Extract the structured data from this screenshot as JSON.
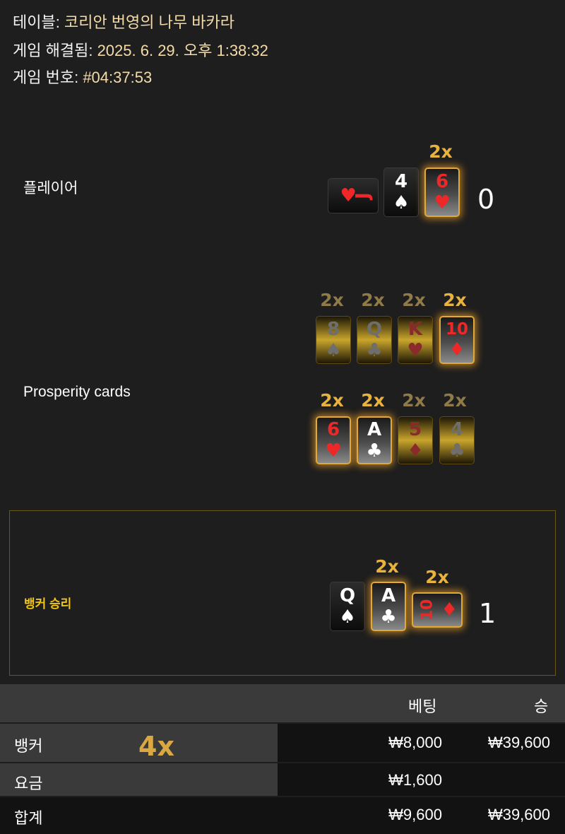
{
  "info": {
    "table_label": "테이블:",
    "table_value": "코리안 번영의 나무 바카라",
    "resolved_label": "게임 해결됨:",
    "resolved_value": "2025. 6. 29. 오후 1:38:32",
    "game_label": "게임 번호:",
    "game_value": "#04:37:53"
  },
  "player": {
    "label": "플레이어",
    "score": "0",
    "cards": [
      {
        "rank": "J",
        "suit": "♥",
        "color": "#ee2828",
        "sideways": true
      },
      {
        "rank": "4",
        "suit": "♠",
        "color": "#ffffff"
      },
      {
        "rank": "6",
        "suit": "♥",
        "color": "#ee2828",
        "multiplier": "2x"
      }
    ]
  },
  "prosperity": {
    "label": "Prosperity cards",
    "row1": [
      {
        "rank": "8",
        "suit": "♠",
        "multiplier": "2x"
      },
      {
        "rank": "Q",
        "suit": "♣",
        "multiplier": "2x"
      },
      {
        "rank": "K",
        "suit": "♥",
        "multiplier": "2x"
      },
      {
        "rank": "10",
        "suit": "♦",
        "multiplier": "2x"
      }
    ],
    "row2": [
      {
        "rank": "6",
        "suit": "♥",
        "multiplier": "2x"
      },
      {
        "rank": "A",
        "suit": "♣",
        "multiplier": "2x"
      },
      {
        "rank": "5",
        "suit": "♦",
        "multiplier": "2x"
      },
      {
        "rank": "4",
        "suit": "♣",
        "multiplier": "2x"
      }
    ]
  },
  "banker": {
    "label": "뱅커 승리",
    "score": "1",
    "cards": [
      {
        "rank": "Q",
        "suit": "♠",
        "color": "#ffffff"
      },
      {
        "rank": "A",
        "suit": "♣",
        "color": "#ffffff",
        "multiplier": "2x"
      },
      {
        "rank": "10",
        "suit": "♦",
        "color": "#ee2828",
        "multiplier": "2x",
        "sideways": true
      }
    ]
  },
  "table": {
    "col_bet": "베팅",
    "col_win": "승",
    "rows": [
      {
        "name": "뱅커",
        "multiplier": "4x",
        "bet": "₩8,000",
        "win": "₩39,600"
      },
      {
        "name": "요금",
        "bet": "₩1,600",
        "win": ""
      },
      {
        "name": "합계",
        "bet": "₩9,600",
        "win": "₩39,600"
      }
    ]
  },
  "colors": {
    "accent_gold": "#e8b23c",
    "banker_label": "#f0c419",
    "red_suit": "#ee2828"
  }
}
